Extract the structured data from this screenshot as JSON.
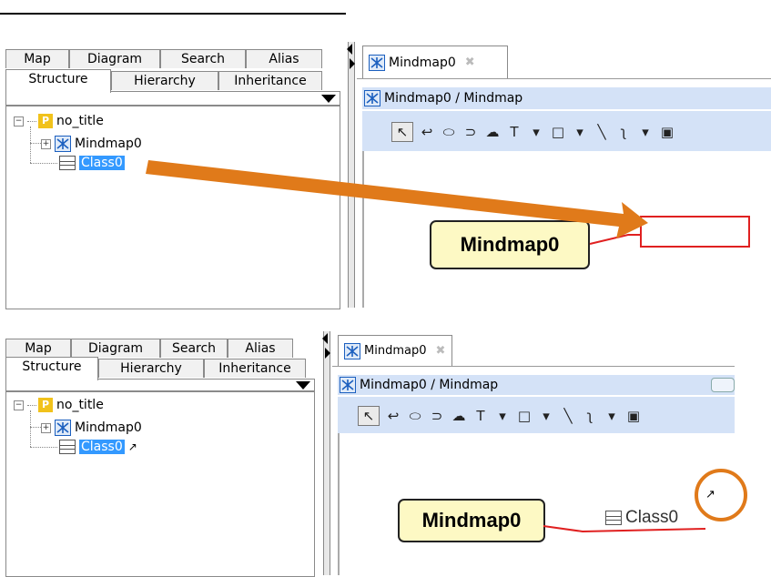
{
  "top": {
    "tabs_row1": [
      "Map",
      "Diagram",
      "Search",
      "Alias"
    ],
    "tabs_row2": [
      "Structure",
      "Hierarchy",
      "Inheritance"
    ],
    "tree": {
      "root": {
        "icon": "project-icon",
        "icon_text": "P",
        "label": "no_title"
      },
      "mindmap": {
        "icon": "mindmap-diagram-icon",
        "label": "Mindmap0"
      },
      "class": {
        "icon": "class-icon",
        "label": "Class0"
      }
    },
    "editor_tab": {
      "label": "Mindmap0"
    },
    "diagram_title": "Mindmap0 / Mindmap",
    "node_label": "Mindmap0",
    "colors": {
      "drag_arrow": "#e07a1a",
      "placeholder_box": "#e02020",
      "connector": "#e02020"
    }
  },
  "bottom": {
    "tabs_row1": [
      "Map",
      "Diagram",
      "Search",
      "Alias"
    ],
    "tabs_row2": [
      "Structure",
      "Hierarchy",
      "Inheritance"
    ],
    "tree": {
      "root": {
        "icon": "project-icon",
        "icon_text": "P",
        "label": "no_title"
      },
      "mindmap": {
        "icon": "mindmap-diagram-icon",
        "label": "Mindmap0"
      },
      "class": {
        "icon": "class-icon",
        "label": "Class0",
        "link_icon": "external-link-icon"
      }
    },
    "editor_tab": {
      "label": "Mindmap0"
    },
    "diagram_title": "Mindmap0 / Mindmap",
    "node_label": "Mindmap0",
    "class_topic_label": "Class0",
    "colors": {
      "highlight_circle": "#e07a1a",
      "connector": "#e02020"
    }
  },
  "toolbar_tools": [
    "select-tool",
    "curve-tool",
    "oval-tool",
    "link-tool",
    "cloud-tool",
    "text-tool",
    "rectangle-tool",
    "line-tool",
    "freehand-tool",
    "image-tool"
  ],
  "toolbar_glyphs": {
    "select": "↖",
    "curve": "↩",
    "oval": "⬭",
    "link": "⊃",
    "cloud": "☁",
    "text": "T",
    "dropdown": "▾",
    "rect": "□",
    "line": "╲",
    "freehand": "ʅ",
    "image": "▣"
  }
}
